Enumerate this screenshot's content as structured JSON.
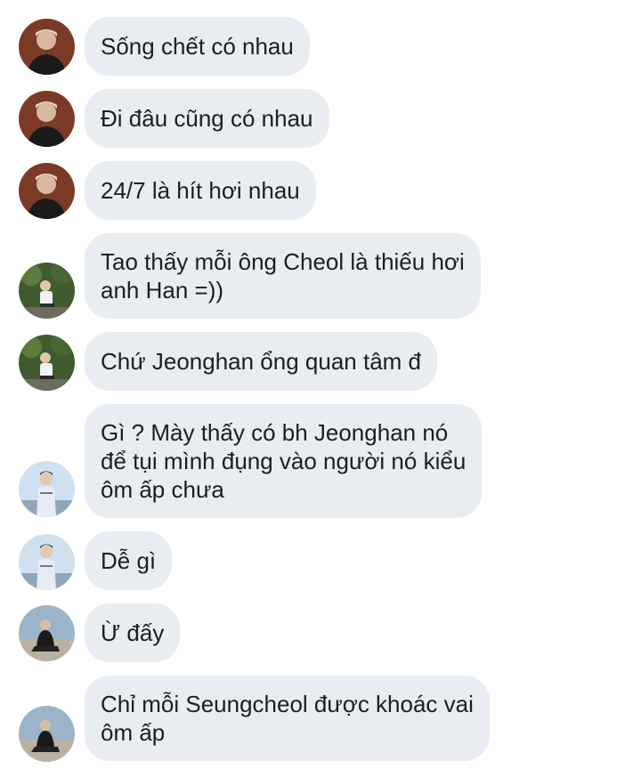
{
  "messages": [
    {
      "text": "Sống chết có nhau",
      "sender": "user-a"
    },
    {
      "text": "Đi đâu cũng có nhau",
      "sender": "user-a"
    },
    {
      "text": "24/7 là hít hơi nhau",
      "sender": "user-a"
    },
    {
      "text": "Tao thấy mỗi ông Cheol là thiếu hơi\nanh Han =))",
      "sender": "user-b"
    },
    {
      "text": "Chứ Jeonghan ổng quan tâm đ",
      "sender": "user-b"
    },
    {
      "text": "Gì ? Mày thấy có bh Jeonghan nó\nđể tụi mình đụng vào người nó kiểu\nôm ấp chưa",
      "sender": "user-c"
    },
    {
      "text": "Dễ gì",
      "sender": "user-c"
    },
    {
      "text": "Ừ đấy",
      "sender": "user-d"
    },
    {
      "text": "Chỉ mỗi Seungcheol được khoác vai\nôm ấp",
      "sender": "user-d"
    }
  ],
  "colors": {
    "bubble_bg": "#e9edf1",
    "text": "#1c1e21",
    "background": "#ffffff"
  }
}
